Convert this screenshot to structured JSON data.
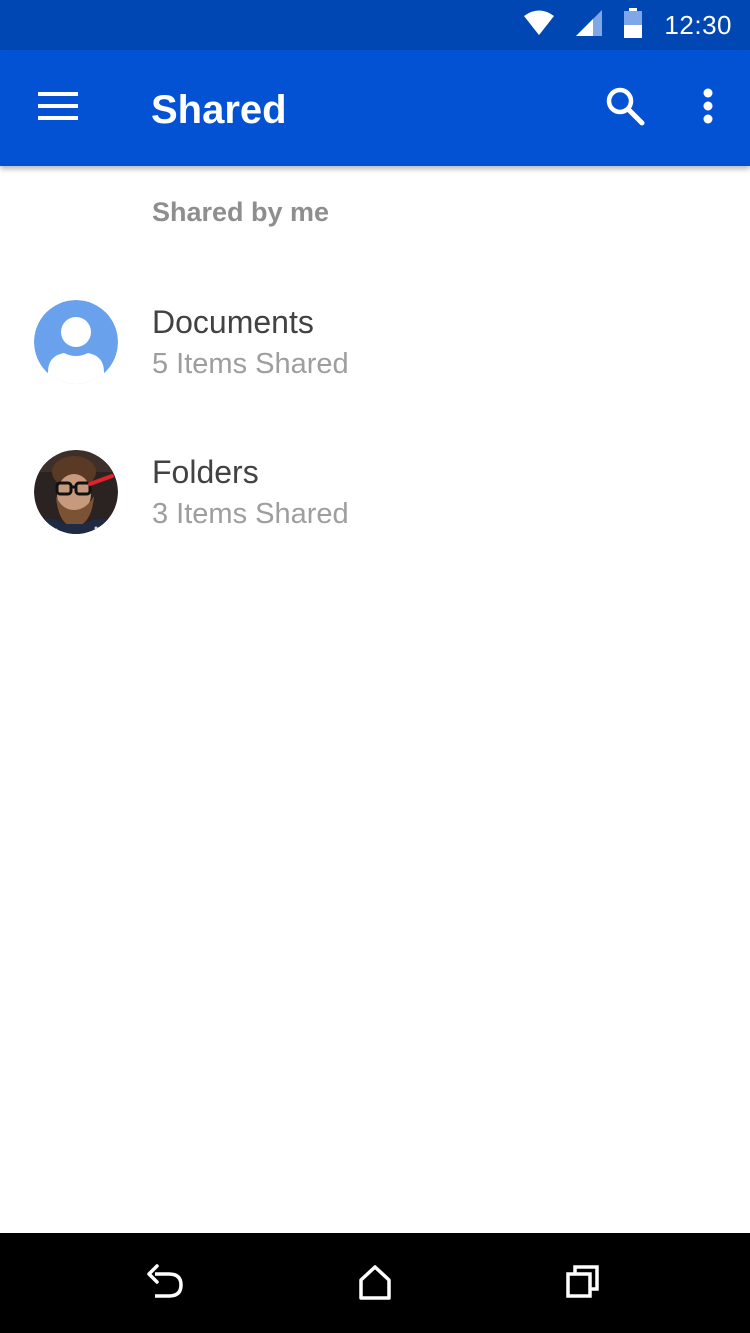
{
  "status_bar": {
    "time": "12:30",
    "icons": [
      "wifi-icon",
      "cell-signal-icon",
      "battery-icon"
    ]
  },
  "app_bar": {
    "title": "Shared",
    "icons": [
      "menu-icon",
      "search-icon",
      "more-vert-icon"
    ]
  },
  "section": {
    "header": "Shared by me"
  },
  "list": {
    "items": [
      {
        "title": "Documents",
        "subtitle": "5 Items Shared",
        "avatar": "default-person-avatar"
      },
      {
        "title": "Folders",
        "subtitle": "3 Items Shared",
        "avatar": "user-photo-avatar"
      }
    ]
  },
  "nav_bar": {
    "icons": [
      "back-icon",
      "home-icon",
      "recents-icon"
    ]
  },
  "colors": {
    "status_bar": "#0047b3",
    "app_bar": "#0352d4",
    "avatar_default": "#6aa1ec",
    "title_text": "#424242",
    "secondary_text": "#9e9e9e",
    "nav_bar": "#000000"
  }
}
